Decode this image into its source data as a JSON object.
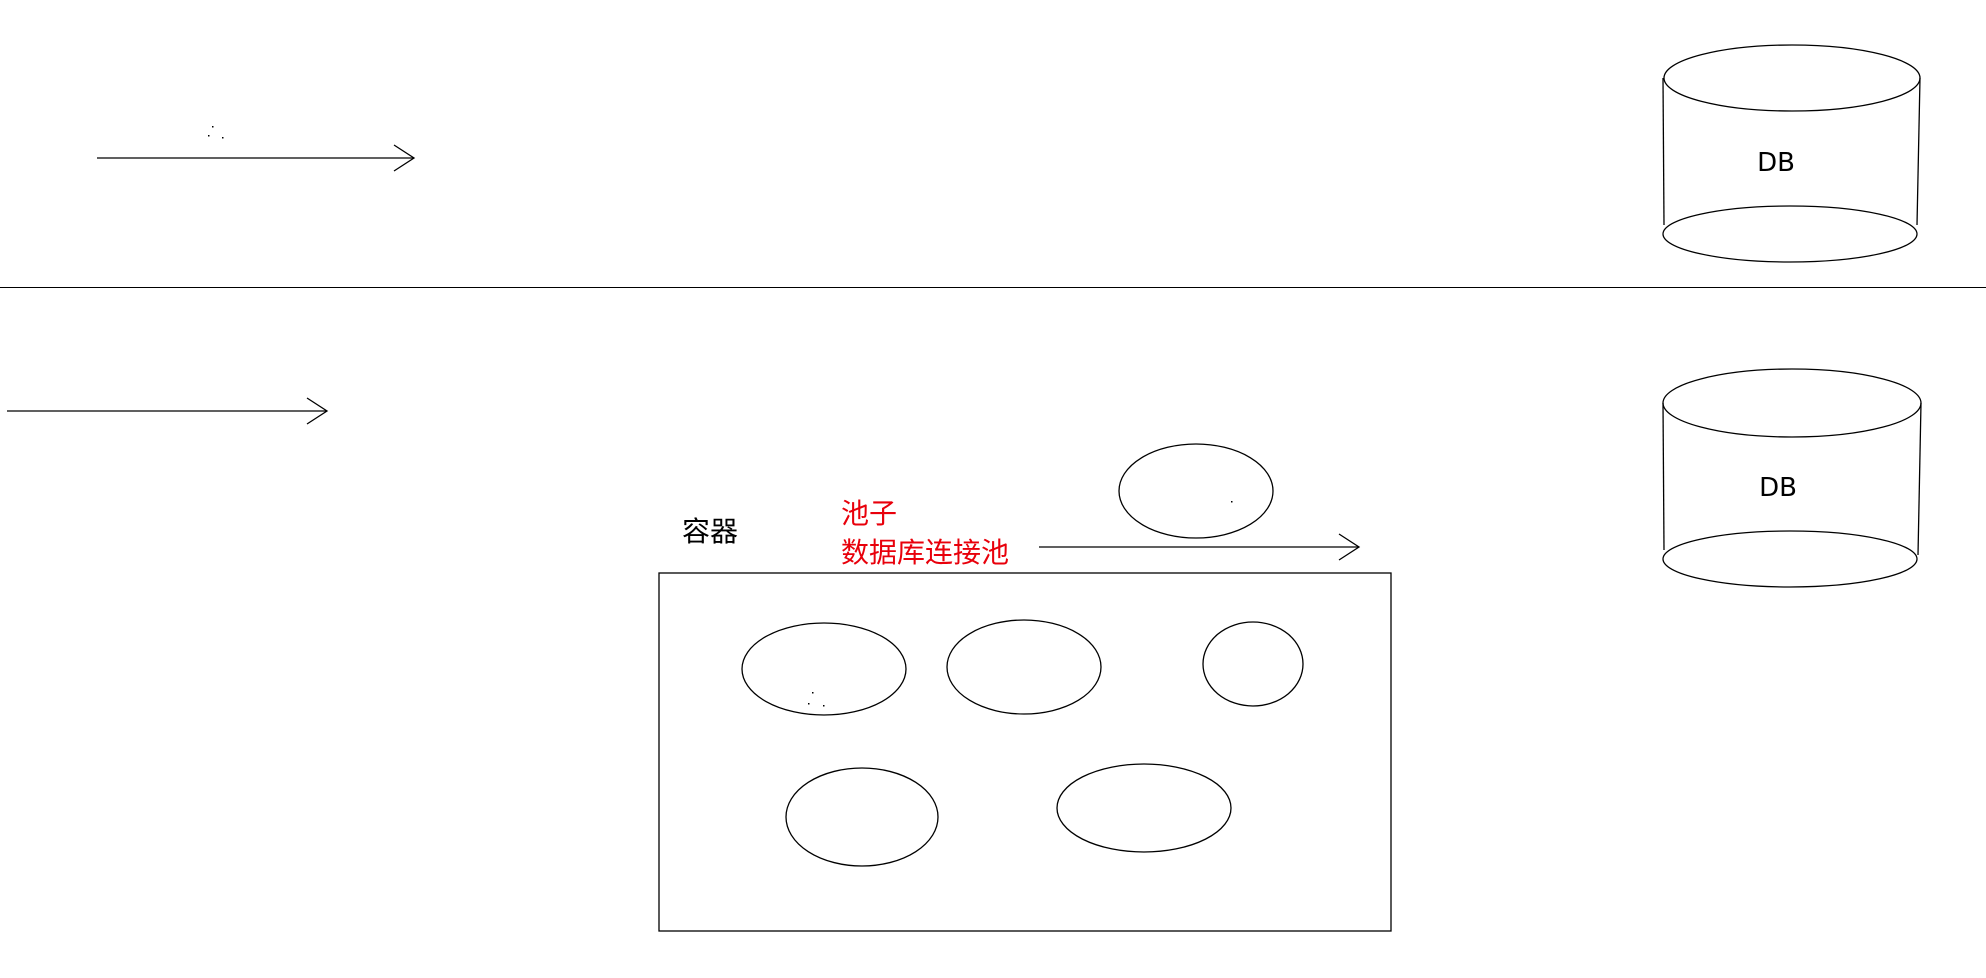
{
  "top_section": {
    "database_label": "DB"
  },
  "bottom_section": {
    "database_label": "DB",
    "container_label": "容器",
    "pool_label": "池子",
    "pool_full_label": "数据库连接池"
  },
  "colors": {
    "line": "#000000",
    "background": "#ffffff",
    "pool_text": "#e8000b"
  }
}
